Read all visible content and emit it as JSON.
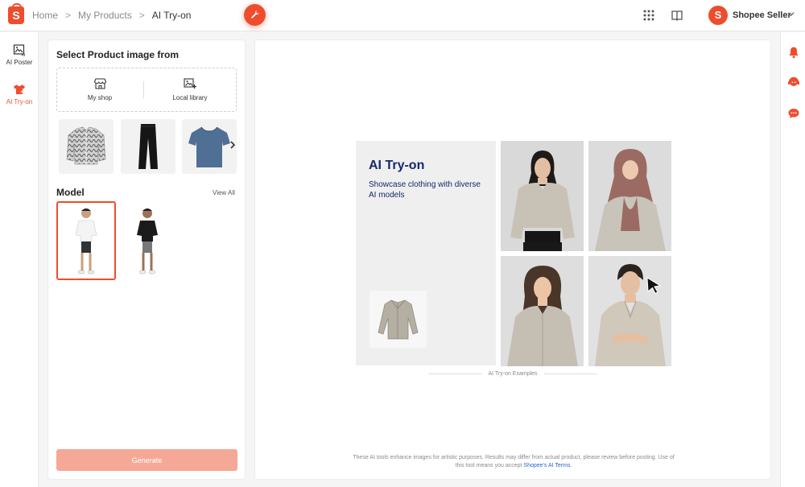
{
  "header": {
    "logo_letter": "S",
    "breadcrumbs": [
      "Home",
      "My Products",
      "AI Try-on"
    ],
    "breadcrumb_separator": ">",
    "fab_icon": "wrench-icon",
    "icons": [
      "apps-grid-icon",
      "book-icon"
    ],
    "avatar_letter": "S",
    "seller_name": "Shopee Seller",
    "dropdown_icon": "caret-down-icon"
  },
  "sidebar": {
    "items": [
      {
        "label": "AI Poster",
        "icon": "image-ai-icon",
        "active": false
      },
      {
        "label": "AI Try-on",
        "icon": "shirt-ai-icon",
        "active": true
      }
    ]
  },
  "left_panel": {
    "title": "Select Product image from",
    "sources": [
      {
        "label": "My shop",
        "icon": "shop-icon"
      },
      {
        "label": "Local library",
        "icon": "image-add-icon"
      }
    ],
    "products": [
      "patterned-jacket",
      "black-trousers",
      "blue-tshirt"
    ],
    "next_icon": "chevron-right-icon",
    "model_title": "Model",
    "view_all": "View All",
    "models": [
      "model-white-tshirt",
      "model-black-tshirt"
    ],
    "selected_model": 0,
    "generate_label": "Generate"
  },
  "showcase": {
    "title": "AI Try-on",
    "subtitle": "Showcase clothing with diverse AI models",
    "examples_caption": "AI Try-on Examples",
    "cursor_icon": "arrow-cursor-icon"
  },
  "footer": {
    "disclaimer": "These AI tools enhance images for artistic purposes. Results may differ from actual product, please review before posting. Use of this tool means you accept",
    "terms_link": "Shopee's AI Terms",
    "terms_end": "."
  },
  "right_rail": {
    "icons": [
      "bell-icon",
      "support-agent-icon",
      "chat-icon"
    ]
  },
  "colors": {
    "brand": "#ee4d2d",
    "generate_disabled": "#f6a896",
    "promo_text": "#13296b",
    "link": "#2b61d1"
  }
}
